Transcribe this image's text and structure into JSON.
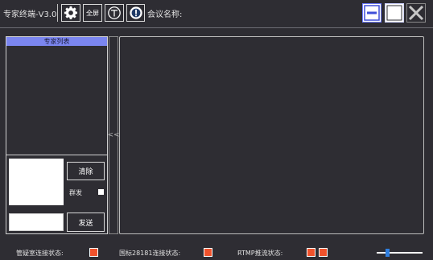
{
  "titlebar": {
    "app_title": "专家终端-V3.0",
    "fullscreen_label": "全屏",
    "meeting_name_label": "会议名称:",
    "meeting_name_value": ""
  },
  "expert_panel": {
    "header": "专家列表",
    "clear_label": "清除",
    "mass_send_label": "群发",
    "send_label": "发送",
    "message_value": "",
    "send_input_value": ""
  },
  "collapse": {
    "label": "<<"
  },
  "statusbar": {
    "consult_room_label": "管疑室连接状态:",
    "gb28181_label": "国标28181连接状态:",
    "rtmp_label": "RTMP推流状态:",
    "status_color": "#f0522c",
    "volume_level": 0.22
  },
  "colors": {
    "background": "#2e2d33",
    "accent": "#7b86f0",
    "slider": "#2f7fe0",
    "indicator": "#f0522c"
  },
  "icons": {
    "settings": "gear-icon",
    "tools": "wrench-icon",
    "info": "info-icon",
    "minimize": "minimize-icon",
    "maximize": "maximize-icon",
    "close": "close-icon"
  }
}
